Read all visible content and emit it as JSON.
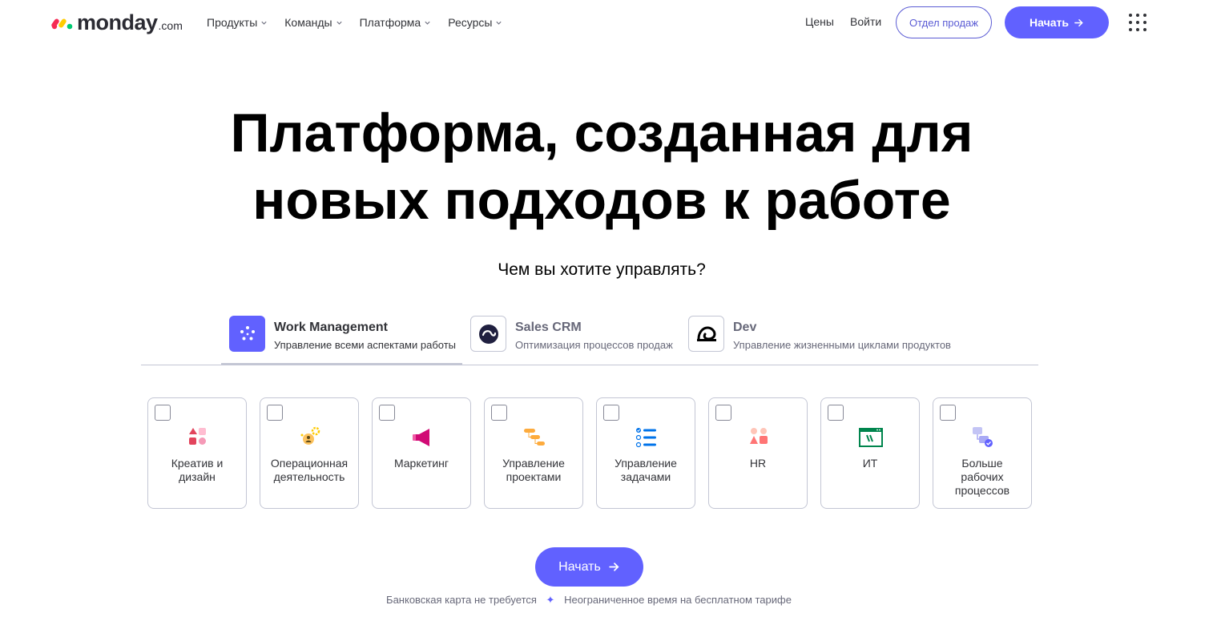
{
  "header": {
    "logo_word": "monday",
    "logo_suffix": ".com",
    "nav": [
      {
        "label": "Продукты"
      },
      {
        "label": "Команды"
      },
      {
        "label": "Платформа"
      },
      {
        "label": "Ресурсы"
      }
    ],
    "price_link": "Цены",
    "login_link": "Войти",
    "sales_button": "Отдел продаж",
    "start_button": "Начать"
  },
  "hero": {
    "title_line1": "Платформа, созданная для",
    "title_line2": "новых подходов к работе",
    "subtitle": "Чем вы хотите управлять?"
  },
  "tabs": [
    {
      "name": "Work Management",
      "desc": "Управление всеми аспектами работы",
      "active": true,
      "color": "#6161ff"
    },
    {
      "name": "Sales CRM",
      "desc": "Оптимизация процессов продаж",
      "active": false,
      "color": "#202040"
    },
    {
      "name": "Dev",
      "desc": "Управление жизненными циклами продуктов",
      "active": false,
      "color": "#000000"
    }
  ],
  "cards": [
    {
      "line1": "Креатив и",
      "line2": "дизайн",
      "line3": "",
      "icon": "shapes-icon"
    },
    {
      "line1": "Операционная",
      "line2": "деятельность",
      "line3": "",
      "icon": "operations-gear-icon"
    },
    {
      "line1": "Маркетинг",
      "line2": "",
      "line3": "",
      "icon": "megaphone-icon"
    },
    {
      "line1": "Управление",
      "line2": "проектами",
      "line3": "",
      "icon": "gantt-icon"
    },
    {
      "line1": "Управление",
      "line2": "задачами",
      "line3": "",
      "icon": "checklist-icon"
    },
    {
      "line1": "HR",
      "line2": "",
      "line3": "",
      "icon": "people-icon"
    },
    {
      "line1": "ИТ",
      "line2": "",
      "line3": "",
      "icon": "it-window-icon"
    },
    {
      "line1": "Больше",
      "line2": "рабочих",
      "line3": "процессов",
      "icon": "workflow-icon"
    }
  ],
  "cta": {
    "start_button": "Начать",
    "note_left": "Банковская карта не требуется",
    "note_sep": "✦",
    "note_right": "Неограниченное время на бесплатном тарифе"
  },
  "colors": {
    "accent": "#6161ff",
    "text": "#323338",
    "border": "#c3c6d4"
  }
}
